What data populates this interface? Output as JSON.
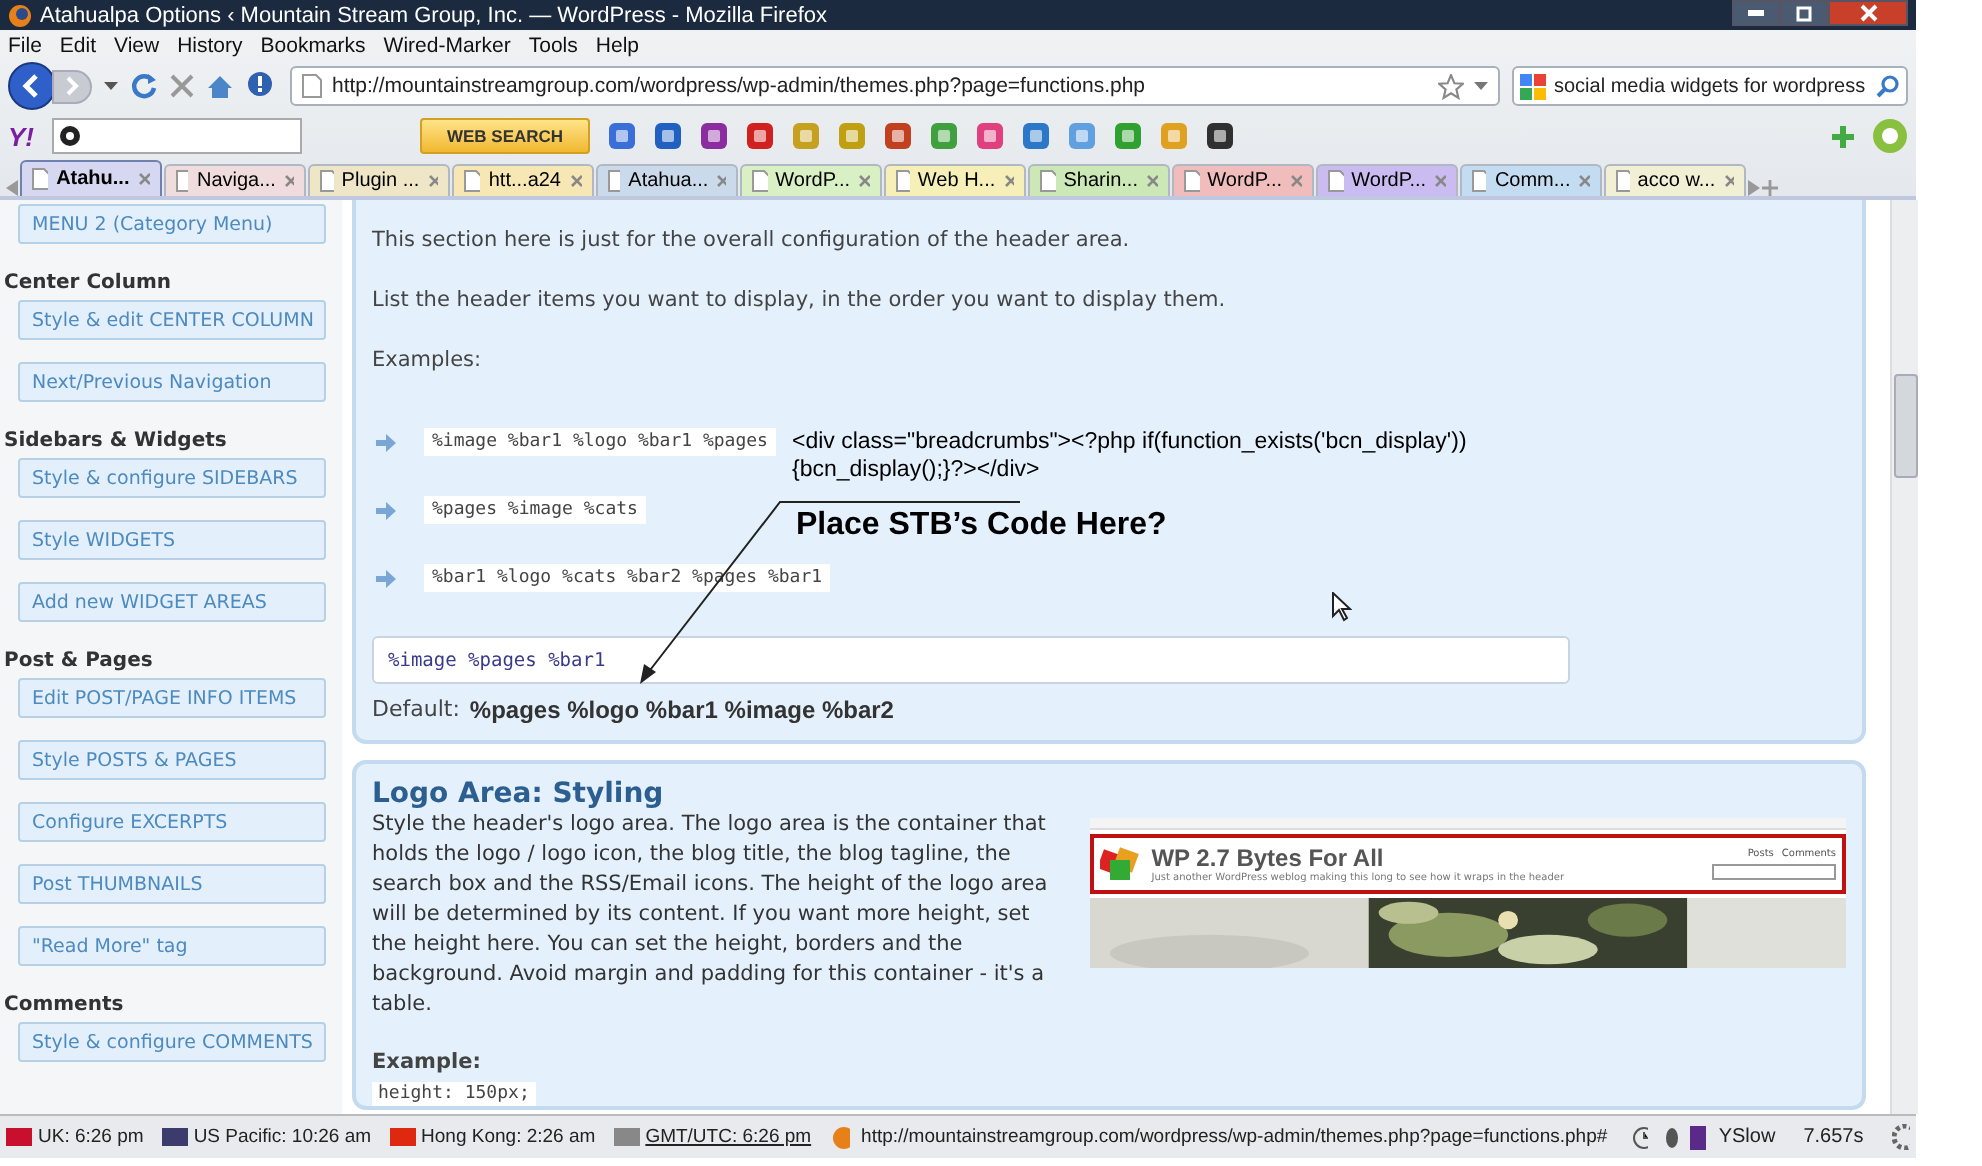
{
  "window": {
    "title": "Atahualpa Options ‹ Mountain Stream Group, Inc. — WordPress - Mozilla Firefox"
  },
  "menu": [
    "File",
    "Edit",
    "View",
    "History",
    "Bookmarks",
    "Wired-Marker",
    "Tools",
    "Help"
  ],
  "address_bar": {
    "value": "http://mountainstreamgroup.com/wordpress/wp-admin/themes.php?page=functions.php"
  },
  "search_bar": {
    "value": "social media widgets for wordpress"
  },
  "yahoo_toolbar": {
    "logo": "Y!",
    "button": "WEB SEARCH"
  },
  "tabs": [
    {
      "label": "Atahu...",
      "selected": true,
      "color": "#d6d8f2"
    },
    {
      "label": "Naviga...",
      "selected": false,
      "color": "#f0dcdc"
    },
    {
      "label": "Plugin ...",
      "selected": false,
      "color": "#efe6c8"
    },
    {
      "label": "htt...a24",
      "selected": false,
      "color": "#f7e7b4"
    },
    {
      "label": "Atahua...",
      "selected": false,
      "color": "#cbdaea"
    },
    {
      "label": "WordP...",
      "selected": false,
      "color": "#d9f0c4"
    },
    {
      "label": "Web H...",
      "selected": false,
      "color": "#f6f0b8"
    },
    {
      "label": "Sharin...",
      "selected": false,
      "color": "#cbe8b6"
    },
    {
      "label": "WordP...",
      "selected": false,
      "color": "#f0bcbc"
    },
    {
      "label": "WordP...",
      "selected": false,
      "color": "#cabcf0"
    },
    {
      "label": "Comm...",
      "selected": false,
      "color": "#c4dcf2"
    },
    {
      "label": "acco w...",
      "selected": false,
      "color": "#f2f0d4"
    }
  ],
  "sidebar": {
    "items": [
      {
        "kind": "button",
        "label": "MENU 2 (Category Menu)"
      },
      {
        "kind": "heading",
        "label": "Center Column"
      },
      {
        "kind": "button",
        "label": "Style & edit CENTER COLUMN"
      },
      {
        "kind": "button",
        "label": "Next/Previous Navigation"
      },
      {
        "kind": "heading",
        "label": "Sidebars & Widgets"
      },
      {
        "kind": "button",
        "label": "Style & configure SIDEBARS"
      },
      {
        "kind": "button",
        "label": "Style WIDGETS"
      },
      {
        "kind": "button",
        "label": "Add new WIDGET AREAS"
      },
      {
        "kind": "heading",
        "label": "Post & Pages"
      },
      {
        "kind": "button",
        "label": "Edit POST/PAGE INFO ITEMS"
      },
      {
        "kind": "button",
        "label": "Style POSTS & PAGES"
      },
      {
        "kind": "button",
        "label": "Configure EXCERPTS"
      },
      {
        "kind": "button",
        "label": "Post THUMBNAILS"
      },
      {
        "kind": "button",
        "label": "\"Read More\" tag"
      },
      {
        "kind": "heading",
        "label": "Comments"
      },
      {
        "kind": "button",
        "label": "Style & configure COMMENTS"
      }
    ]
  },
  "header_section": {
    "intro": "This section here is just for the overall configuration of the header area.",
    "instruction": "List the header items you want to display, in the order you want to display them.",
    "examples_label": "Examples:",
    "examples": [
      "%image %bar1 %logo %bar1 %pages",
      "%pages %image %cats",
      "%bar1 %logo %cats %bar2 %pages %bar1"
    ],
    "field_value": "%image %pages %bar1",
    "default_label": "Default:",
    "default_value": "%pages %logo %bar1 %image %bar2"
  },
  "annotation": {
    "code": "<div class=\"breadcrumbs\"><?php if(function_exists('bcn_display'))\n{bcn_display();}?></div>",
    "question": "Place STB’s Code Here?"
  },
  "logo_section": {
    "title": "Logo Area: Styling",
    "description": "Style the header's logo area. The logo area is the container that holds the logo / logo icon, the blog title, the blog tagline, the search box and the RSS/Email icons. The height of the logo area will be determined by its content. If you want more height, set the height here. You can set the height, borders and the background. Avoid margin and padding for this container - it's a table.",
    "example_label": "Example:",
    "example_code": "height: 150px;",
    "preview": {
      "blog_title": "WP 2.7 Bytes For All",
      "tagline": "Just another WordPress weblog making this long to see how it wraps in the header",
      "links": [
        "Posts",
        "Comments"
      ]
    }
  },
  "status_bar": {
    "clocks": [
      {
        "label": "UK: 6:26 pm",
        "color": "#c8102e"
      },
      {
        "label": "US Pacific: 10:26 am",
        "color": "#3c3b6e"
      },
      {
        "label": "Hong Kong: 2:26 am",
        "color": "#de2910"
      },
      {
        "label": "GMT/UTC: 6:26 pm",
        "color": "#888888"
      }
    ],
    "url": "http://mountainstreamgroup.com/wordpress/wp-admin/themes.php?page=functions.php#",
    "yslow": "YSlow",
    "time": "7.657s"
  }
}
